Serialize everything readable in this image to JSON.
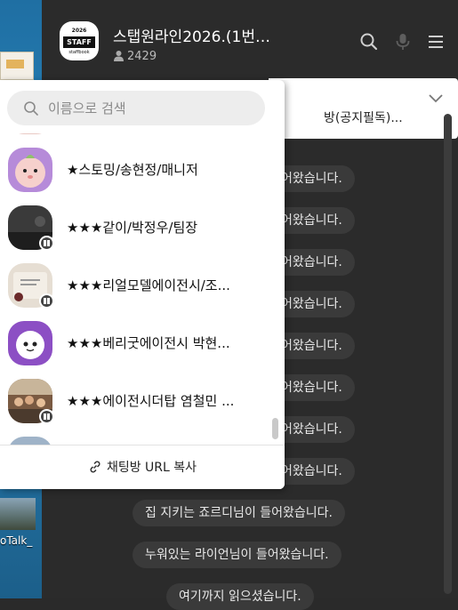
{
  "desktop": {
    "icon_label": "oTalk_"
  },
  "topbar": {
    "dots": "••"
  },
  "header": {
    "avatar": {
      "year": "2026",
      "badge": "STAFF",
      "sub": "staffbook"
    },
    "title": "스탭원라인2026.(1번방) 행사...",
    "member_count": "2429",
    "icons": [
      "search-icon",
      "mic-icon",
      "menu-icon"
    ]
  },
  "notice": {
    "text": "방(공지필독)..."
  },
  "system_messages": [
    "어왔습니다.",
    "어왔습니다.",
    "어왔습니다.",
    "어왔습니다.",
    "어왔습니다.",
    "어왔습니다.",
    "어왔습니다.",
    "어왔습니다.",
    "어왔습니다.",
    "집 지키는 죠르디님이 들어왔습니다.",
    "누워있는 라이언님이 들어왔습니다.",
    "여기까지 읽으셨습니다."
  ],
  "popup": {
    "search_placeholder": "이름으로 검색",
    "members": [
      {
        "name": "★스토밍/송현정/매니저",
        "avatar": "peach-character"
      },
      {
        "name": "★★★같이/박정우/팀장",
        "avatar": "dark-photo"
      },
      {
        "name": "★★★리얼모델에이전시/조...",
        "avatar": "logo-card"
      },
      {
        "name": "★★★베리굿에이전시 박현...",
        "avatar": "purple-character"
      },
      {
        "name": "★★★에이전시더탑 염철민 ...",
        "avatar": "group-photo"
      }
    ],
    "copy_url_label": "채팅방 URL 복사"
  },
  "colors": {
    "chat_bg": "#2b2b2b",
    "bubble_bg": "#3a3a3a",
    "popup_bg": "#ffffff"
  }
}
